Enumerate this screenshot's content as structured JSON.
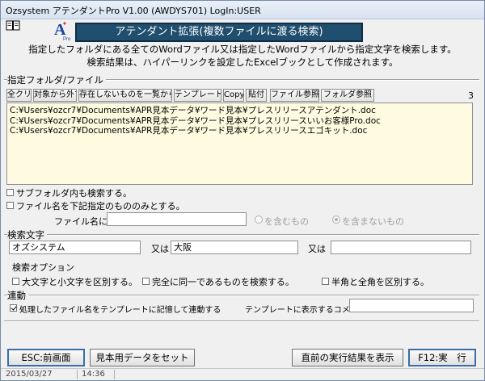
{
  "window": {
    "title": "Ozsystem アテンダントPro V1.00 (AWDYS701)  LogIn:USER"
  },
  "header": {
    "banner": "アテンダント拡張(複数ファイルに渡る検索)",
    "desc1": "指定したフォルダにある全てのWordファイル又は指定したWordファイルから指定文字を検索します。",
    "desc2": "検索結果は、ハイパーリンクを設定したExcelブックとして作成されます。"
  },
  "folder_section": {
    "label": "指定フォルダ/ファイル",
    "buttons": [
      "全クリア",
      "対象から外す",
      "存在しないものを一覧から外す",
      "テンプレート",
      "Copy",
      "貼付",
      "ファイル参照",
      "フォルダ参照"
    ],
    "count": "3",
    "files": [
      "C:¥Users¥ozcr7¥Documents¥APR見本データ¥ワード見本¥プレスリリースアテンダント.doc",
      "C:¥Users¥ozcr7¥Documents¥APR見本データ¥ワード見本¥プレスリリースいいお客様Pro.doc",
      "C:¥Users¥ozcr7¥Documents¥APR見本データ¥ワード見本¥プレスリリースエゴキット.doc"
    ],
    "subfolder_label": "サブフォルダ内も検索する。",
    "filename_filter_label": "ファイル名を下記指定のもののみとする。",
    "filename_label": "ファイル名に",
    "filename_value": "",
    "radio_include": "を含むもの",
    "radio_exclude": "を含まないもの"
  },
  "search_section": {
    "label": "検索文字",
    "term1": "オズシステム",
    "or1": "又は",
    "term2": "大阪",
    "or2": "又は",
    "term3": "",
    "options_label": "検索オプション",
    "opt_case": "大文字と小文字を区別する。",
    "opt_exact": "完全に同一であるものを検索する。",
    "opt_width": "半角と全角を区別する。"
  },
  "link_section": {
    "label": "連動",
    "remember_label": "処理したファイル名をテンプレートに記憶して連動する",
    "comment_label": "テンプレートに表示するコメント",
    "comment_value": ""
  },
  "footer": {
    "esc": "ESC:前画面",
    "sample": "見本用データをセット",
    "prev_result": "直前の実行結果を表示",
    "run": "F12:実　行"
  },
  "status": {
    "date": "2015/03/27",
    "time": "14:36"
  }
}
